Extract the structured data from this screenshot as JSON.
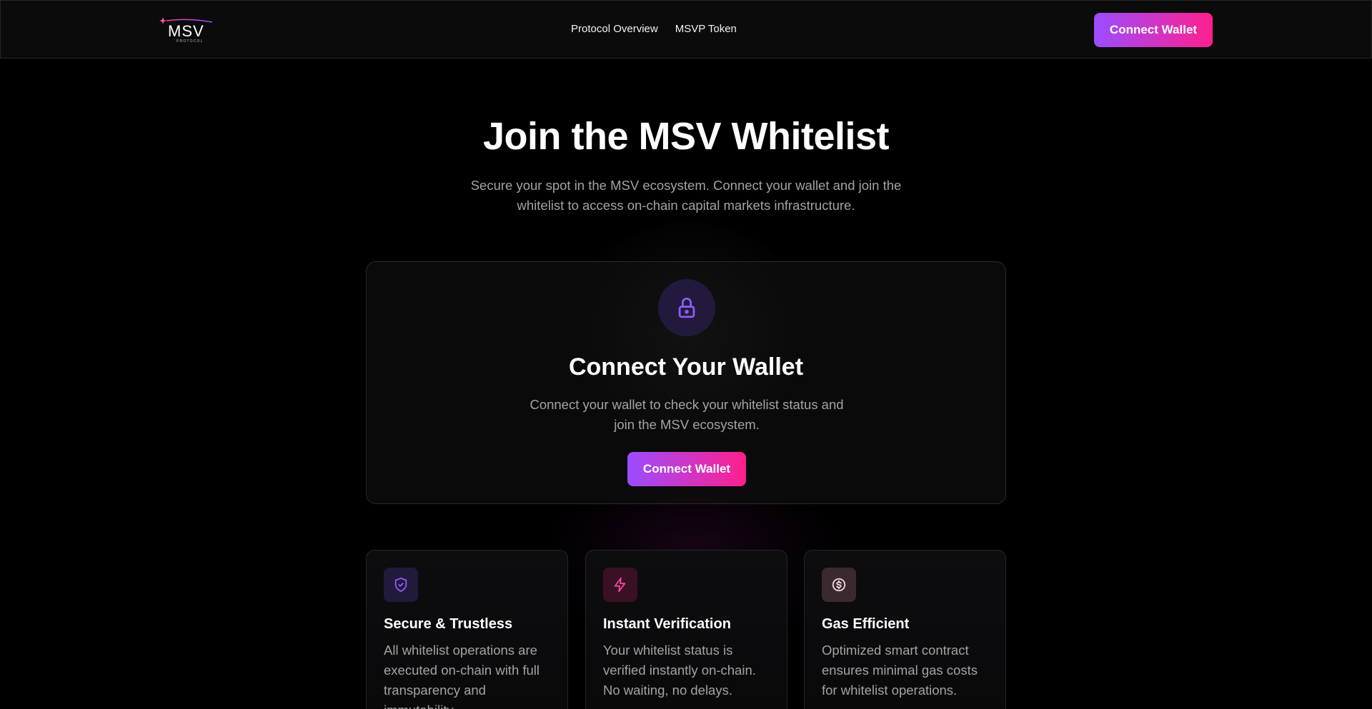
{
  "nav": {
    "logo_text": "MSV",
    "logo_subtext": "PROTOCOL",
    "links": [
      {
        "label": "Protocol Overview"
      },
      {
        "label": "MSVP Token"
      }
    ],
    "connect_label": "Connect Wallet"
  },
  "hero": {
    "title": "Join the MSV Whitelist",
    "subtitle": "Secure your spot in the MSV ecosystem. Connect your wallet and join the whitelist to access on-chain capital markets infrastructure."
  },
  "connect_card": {
    "icon": "lock-icon",
    "title": "Connect Your Wallet",
    "description": "Connect your wallet to check your whitelist status and join the MSV ecosystem.",
    "button_label": "Connect Wallet"
  },
  "features": [
    {
      "icon": "shield-check-icon",
      "title": "Secure & Trustless",
      "description": "All whitelist operations are executed on-chain with full transparency and immutability."
    },
    {
      "icon": "lightning-icon",
      "title": "Instant Verification",
      "description": "Your whitelist status is verified instantly on-chain. No waiting, no delays."
    },
    {
      "icon": "dollar-coin-icon",
      "title": "Gas Efficient",
      "description": "Optimized smart contract ensures minimal gas costs for whitelist operations."
    }
  ],
  "colors": {
    "gradient_start": "#9b4dff",
    "gradient_end": "#ff1f8e",
    "accent_purple": "#8b5cf6",
    "accent_pink": "#ec4899",
    "background": "#000000",
    "muted_text": "#a3a3a3"
  }
}
